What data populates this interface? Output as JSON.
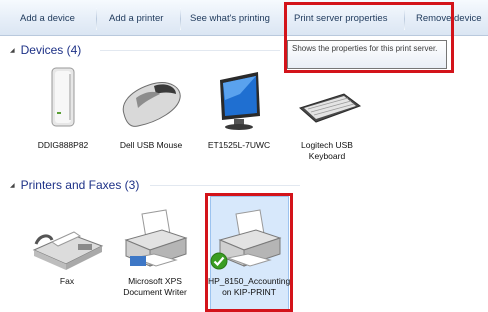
{
  "toolbar": {
    "add_device": "Add a device",
    "add_printer": "Add a printer",
    "see_printing": "See what's printing",
    "print_server": "Print server properties",
    "remove_device": "Remove device"
  },
  "tooltip": {
    "text": "Shows the properties for this print server."
  },
  "devices_group": {
    "title": "Devices (4)",
    "items": [
      {
        "label": "DDIG888P82",
        "icon": "external-drive-icon"
      },
      {
        "label": "Dell USB Mouse",
        "icon": "mouse-icon"
      },
      {
        "label": "ET1525L-7UWC",
        "icon": "monitor-icon"
      },
      {
        "label": "Logitech USB Keyboard",
        "icon": "keyboard-icon"
      }
    ]
  },
  "printers_group": {
    "title": "Printers and Faxes (3)",
    "items": [
      {
        "label": "Fax",
        "icon": "fax-icon"
      },
      {
        "label": "Microsoft XPS Document Writer",
        "icon": "printer-icon"
      },
      {
        "label": "HP_8150_Accounting on KIP-PRINT",
        "icon": "printer-icon",
        "selected": true,
        "default": true
      }
    ]
  },
  "colors": {
    "highlight": "#d3131a",
    "selection": "#d7e8fb",
    "group_title": "#1e3287"
  }
}
